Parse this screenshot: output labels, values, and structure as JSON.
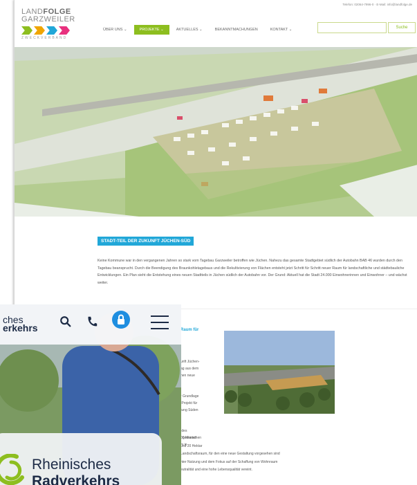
{
  "site": {
    "contact": "Telefon: 02064-7996-0 · E-Mail: info@landfolge.de",
    "logo": {
      "line1_a": "LAND",
      "line1_b": "FOLGE",
      "line2": "GARZWEILER",
      "line3": "ZWECKVERBAND",
      "chevron_colors": [
        "#8dbe1f",
        "#f0a500",
        "#21a7d8",
        "#e8317e"
      ]
    },
    "nav": [
      "ÜBER UNS ⌄",
      "PROJEKTE ⌄",
      "AKTUELLES ⌄",
      "BEKANNTMACHUNGEN",
      "KONTAKT ⌄"
    ],
    "search_button": "Suche",
    "headline": "STADT-TEIL DER ZUKUNFT JÜCHEN-SÜD",
    "body": "Keine Kommune war in den vergangenen Jahren so stark vom Tagebau Garzweiler betroffen wie Jüchen. Nahezu das gesamte Stadtgebiet südlich der Autobahn BAB 46 wurden durch den Tagebau beansprucht. Durch die Beendigung des Braunkohletagebaus und die Rekultivierung von Flächen entsteht jetzt Schritt für Schritt neuer Raum für landschaftliche und städtebauliche Entwicklungen. Ein Plan sieht die Entstehung eines neuen Stadtteils in Jüchen südlich der Autobahn vor. Der Grund: Aktuell hat die Stadt 24.000 Einwohnerinnen und Einwohner – und wächst weiter.",
    "sub_heading": "Raum für",
    "column_lines": [
      "unft Jüchen-",
      "ag aus dem",
      "nen neue",
      "r Grundlage",
      " Projekt für",
      "tung Süden",
      " des",
      "r gestartet",
      "m in"
    ],
    "lower_lines": [
      "00 Menschen",
      "und 20 Hektar",
      " Landschaftsraum, für den eine neue Gestaltung vorgesehen sind",
      "hter Nutzung und dem Fokus auf der Schaffung von Wohnraum",
      "eutralität und eine hohe Lebensqualität vereint."
    ]
  },
  "mobile": {
    "title_line1": "ches",
    "title_line2": "erkehrs",
    "card_line1": "Rheinisches",
    "card_line2": "Radverkehrs"
  },
  "colors": {
    "accent_green": "#8dbe1f",
    "accent_blue": "#21a7d8",
    "navy": "#1c2a45",
    "mobile_blue": "#1f8ee0"
  }
}
